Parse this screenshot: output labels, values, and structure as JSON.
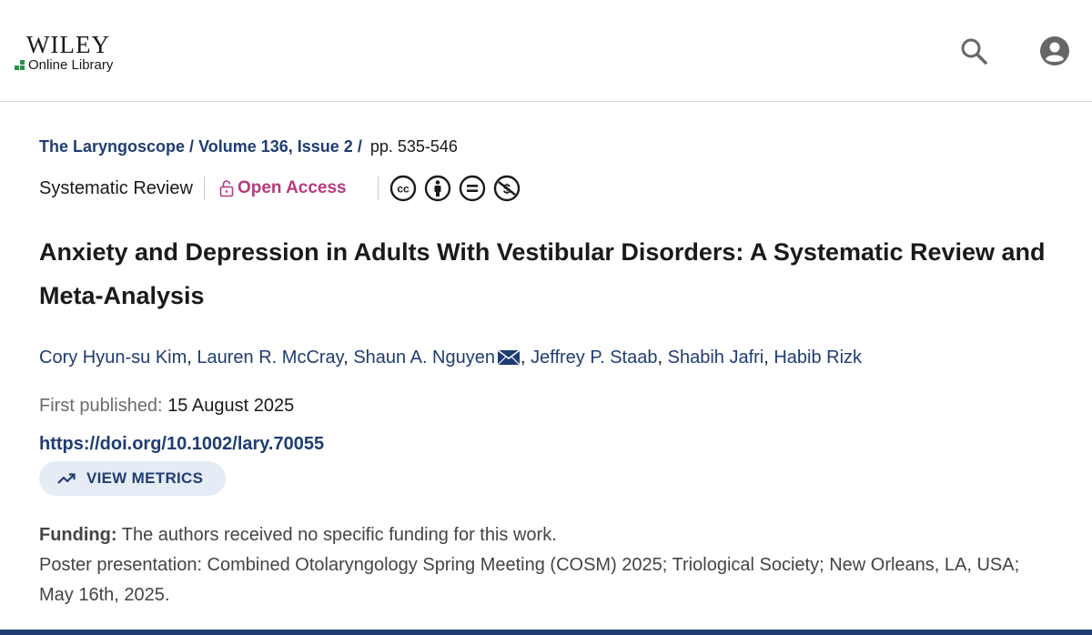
{
  "header": {
    "brand_name": "WILEY",
    "brand_sub": "Online Library",
    "search_icon": "search-icon",
    "account_icon": "user-account-icon"
  },
  "breadcrumb": {
    "journal": "The Laryngoscope",
    "volume": "Volume 136, Issue 2",
    "pages": "pp. 535-546"
  },
  "meta": {
    "article_type": "Systematic Review",
    "access_label": "Open Access",
    "license_icons": [
      "cc-icon",
      "by-icon",
      "nd-icon",
      "nc-icon"
    ]
  },
  "article": {
    "title": "Anxiety and Depression in Adults With Vestibular Disorders: A Systematic Review and Meta-Analysis",
    "authors": [
      "Cory Hyun-su Kim",
      "Lauren R. McCray",
      "Shaun A. Nguyen",
      "Jeffrey P. Staab",
      "Shabih Jafri",
      "Habib Rizk"
    ],
    "first_published_label": "First published:",
    "first_published_date": "15 August 2025",
    "doi": "https://doi.org/10.1002/lary.70055",
    "metrics_label": "VIEW METRICS",
    "funding_label": "Funding:",
    "funding_text": "The authors received no specific funding for this work.",
    "presentation_note": "Poster presentation: Combined Otolaryngology Spring Meeting (COSM) 2025; Triological Society; New Orleans, LA, USA; May 16th, 2025."
  },
  "colors": {
    "link": "#1f3d73",
    "open_access": "#b8397f",
    "brand_green": "#2e8f4d"
  }
}
